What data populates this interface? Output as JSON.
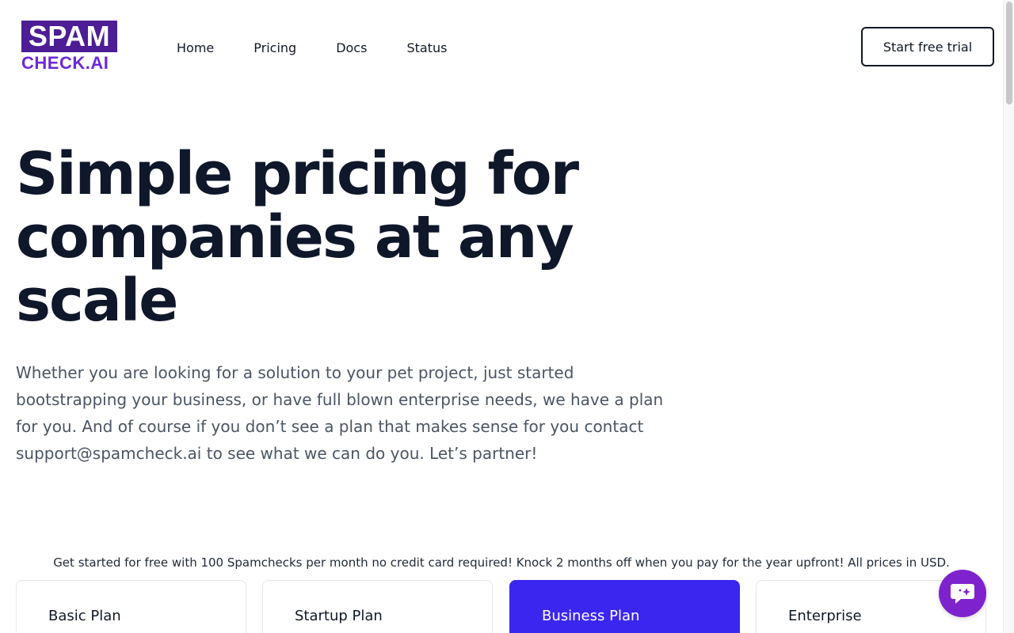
{
  "brand": {
    "logo_top": "SPAM",
    "logo_bottom": "CHECK.AI"
  },
  "nav": {
    "home": "Home",
    "pricing": "Pricing",
    "docs": "Docs",
    "status": "Status"
  },
  "header": {
    "cta_label": "Start free trial"
  },
  "hero": {
    "title": "Simple pricing for companies at any scale",
    "description": "Whether you are looking for a solution to your pet project, just started bootstrapping your business, or have full blown enterprise needs, we have a plan for you. And of course if you don’t see a plan that makes sense for you contact support@spamcheck.ai to see what we can do you. Let’s partner!"
  },
  "promo": {
    "text": "Get started for free with 100 Spamchecks per month no credit card required! Knock 2 months off when you pay for the year upfront! All prices in USD."
  },
  "plans": [
    {
      "name": "Basic Plan"
    },
    {
      "name": "Startup Plan"
    },
    {
      "name": "Business Plan"
    },
    {
      "name": "Enterprise"
    }
  ],
  "colors": {
    "brand_purple": "#4c1d95",
    "featured_plan": "#3b26f0",
    "chat_button": "#7e22ce"
  },
  "icons": {
    "chat": "chat-bubble-sparkle-icon"
  }
}
